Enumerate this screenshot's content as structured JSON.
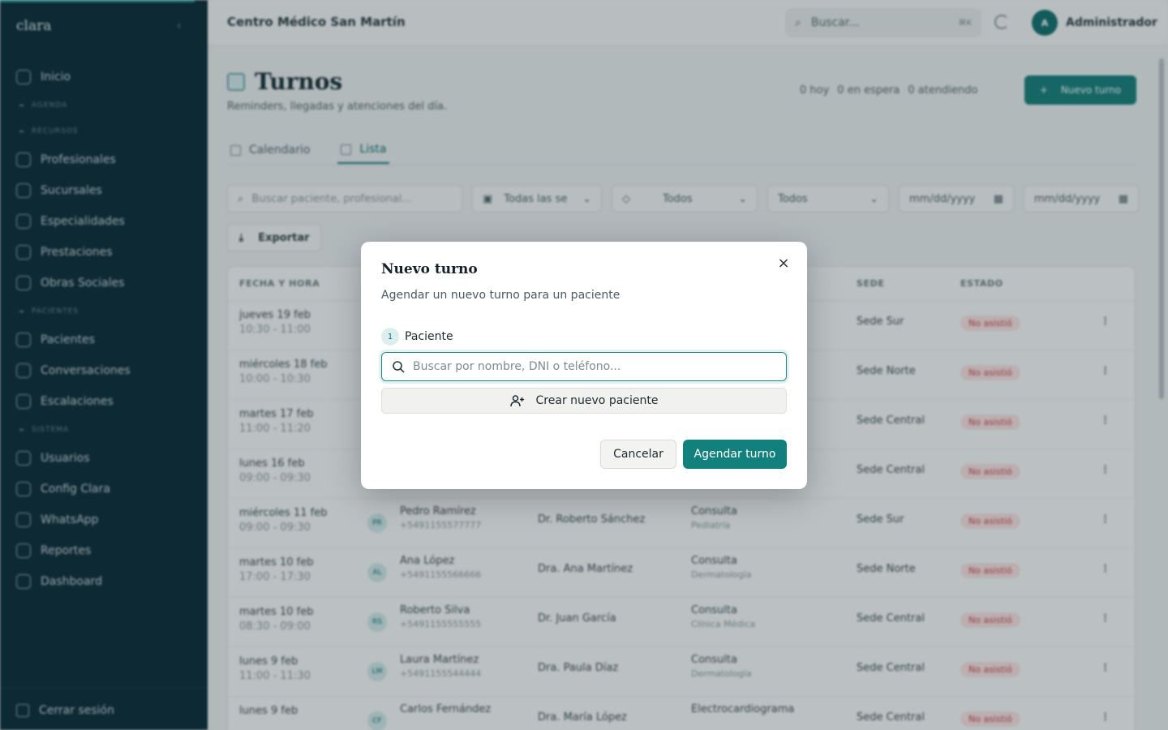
{
  "app": {
    "brand": "clara",
    "clinic_name": "Centro Médico San Martín",
    "search_placeholder": "Buscar...",
    "search_shortcut": "⌘K",
    "user_initial": "A",
    "user_name": "Administrador",
    "accent_color": "#12807c"
  },
  "sidebar": {
    "items": [
      {
        "type": "item",
        "label": "Inicio",
        "icon": "home-icon"
      },
      {
        "type": "section",
        "label": "AGENDA"
      },
      {
        "type": "section",
        "label": "RECURSOS"
      },
      {
        "type": "item",
        "label": "Profesionales",
        "icon": "users-icon"
      },
      {
        "type": "item",
        "label": "Sucursales",
        "icon": "building-icon"
      },
      {
        "type": "item",
        "label": "Especialidades",
        "icon": "stethoscope-icon"
      },
      {
        "type": "item",
        "label": "Prestaciones",
        "icon": "tag-icon"
      },
      {
        "type": "item",
        "label": "Obras Sociales",
        "icon": "heart-icon"
      },
      {
        "type": "section",
        "label": "PACIENTES"
      },
      {
        "type": "item",
        "label": "Pacientes",
        "icon": "user-icon"
      },
      {
        "type": "item",
        "label": "Conversaciones",
        "icon": "chat-icon"
      },
      {
        "type": "item",
        "label": "Escalaciones",
        "icon": "alert-icon"
      },
      {
        "type": "section",
        "label": "SISTEMA"
      },
      {
        "type": "item",
        "label": "Usuarios",
        "icon": "user-cog-icon"
      },
      {
        "type": "item",
        "label": "Config Clara",
        "icon": "settings-icon"
      },
      {
        "type": "item",
        "label": "WhatsApp",
        "icon": "whatsapp-icon"
      },
      {
        "type": "item",
        "label": "Reportes",
        "icon": "report-icon"
      },
      {
        "type": "item",
        "label": "Dashboard",
        "icon": "dashboard-icon"
      }
    ],
    "logout_label": "Cerrar sesión"
  },
  "page": {
    "title": "Turnos",
    "subtitle": "Reminders, llegadas y atenciones del día.",
    "stats": [
      "0 hoy",
      "0 en espera",
      "0 atendiendo"
    ],
    "new_button": "Nuevo turno",
    "tabs": [
      {
        "label": "Calendario"
      },
      {
        "label": "Lista"
      }
    ],
    "filters": {
      "search_placeholder": "Buscar paciente, profesional...",
      "sede": "Todas las se",
      "tipo": "Todos",
      "estado": "Todos",
      "date_from": "mm/dd/yyyy",
      "date_to": "mm/dd/yyyy"
    },
    "export_label": "Exportar"
  },
  "table": {
    "headers": {
      "fecha": "FECHA Y HORA",
      "sede": "SEDE",
      "estado": "ESTADO"
    },
    "rows": [
      {
        "date": "jueves 19 feb",
        "time": "10:30 - 11:00",
        "initials": "",
        "patient": "",
        "phone": "",
        "professional": "",
        "service": "",
        "specialty": "",
        "sede": "Sede Sur",
        "status": "No asistió"
      },
      {
        "date": "miércoles 18 feb",
        "time": "10:00 - 10:30",
        "initials": "",
        "patient": "",
        "phone": "",
        "professional": "",
        "service": "",
        "specialty": "",
        "sede": "Sede Norte",
        "status": "No asistió"
      },
      {
        "date": "martes 17 feb",
        "time": "11:00 - 11:20",
        "initials": "",
        "patient": "",
        "phone": "",
        "professional": "",
        "service": "",
        "specialty": "",
        "sede": "Sede Central",
        "status": "No asistió"
      },
      {
        "date": "lunes 16 feb",
        "time": "09:00 - 09:30",
        "initials": "",
        "patient": "",
        "phone": "",
        "professional": "",
        "service": "",
        "specialty": "",
        "sede": "Sede Central",
        "status": "No asistió"
      },
      {
        "date": "miércoles 11 feb",
        "time": "09:00 - 09:30",
        "initials": "PR",
        "patient": "Pedro Ramírez",
        "phone": "+5491155577777",
        "professional": "Dr. Roberto Sánchez",
        "service": "Consulta",
        "specialty": "Pediatría",
        "sede": "Sede Sur",
        "status": "No asistió"
      },
      {
        "date": "martes 10 feb",
        "time": "17:00 - 17:30",
        "initials": "AL",
        "patient": "Ana López",
        "phone": "+5491155566666",
        "professional": "Dra. Ana Martínez",
        "service": "Consulta",
        "specialty": "Dermatología",
        "sede": "Sede Norte",
        "status": "No asistió"
      },
      {
        "date": "martes 10 feb",
        "time": "08:30 - 09:00",
        "initials": "RS",
        "patient": "Roberto Silva",
        "phone": "+5491155555555",
        "professional": "Dr. Juan García",
        "service": "Consulta",
        "specialty": "Clínica Médica",
        "sede": "Sede Central",
        "status": "No asistió"
      },
      {
        "date": "lunes 9 feb",
        "time": "11:00 - 11:30",
        "initials": "LM",
        "patient": "Laura Martínez",
        "phone": "+5491155544444",
        "professional": "Dra. Paula Díaz",
        "service": "Consulta",
        "specialty": "Dermatología",
        "sede": "Sede Central",
        "status": "No asistió"
      },
      {
        "date": "lunes 9 feb",
        "time": "",
        "initials": "CF",
        "patient": "Carlos Fernández",
        "phone": "",
        "professional": "Dra. María López",
        "service": "Electrocardiograma",
        "specialty": "",
        "sede": "Sede Central",
        "status": "No asistió"
      }
    ]
  },
  "modal": {
    "title": "Nuevo turno",
    "subtitle": "Agendar un nuevo turno para un paciente",
    "step_number": "1",
    "step_label": "Paciente",
    "search_placeholder": "Buscar por nombre, DNI o teléfono...",
    "search_value": "",
    "create_patient_label": "Crear nuevo paciente",
    "cancel_label": "Cancelar",
    "submit_label": "Agendar turno",
    "close_symbol": "×"
  }
}
